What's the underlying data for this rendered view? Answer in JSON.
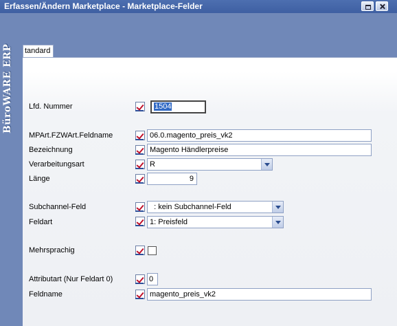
{
  "window": {
    "title": "Erfassen/Ändern Marketplace - Marketplace-Felder"
  },
  "brand": "BüroWARE ERP",
  "tabs": [
    {
      "label": "tandard"
    }
  ],
  "form": {
    "lfd_nummer": {
      "label": "Lfd. Nummer",
      "value": "1504"
    },
    "feldname_mp": {
      "label": "MPArt.FZWArt.Feldname",
      "value": "06.0.magento_preis_vk2"
    },
    "bezeichnung": {
      "label": "Bezeichnung",
      "value": "Magento Händlerpreise"
    },
    "verarbeitungsart": {
      "label": "Verarbeitungsart",
      "value": "R"
    },
    "laenge": {
      "label": "Länge",
      "value": "9"
    },
    "subchannel": {
      "label": "Subchannel-Feld",
      "value": "  : kein Subchannel-Feld"
    },
    "feldart": {
      "label": "Feldart",
      "value": "1: Preisfeld"
    },
    "mehrsprachig": {
      "label": "Mehrsprachig",
      "checked": false
    },
    "attributart": {
      "label": "Attributart (Nur Feldart 0)",
      "value": "0"
    },
    "feldname": {
      "label": "Feldname",
      "value": "magento_preis_vk2"
    }
  },
  "colors": {
    "titlebar": "#3e5fa2",
    "background": "#7088b8",
    "selection": "#316ac5",
    "check_mark": "#c0102a"
  },
  "icons": {
    "edit_check": "red-check-edit-icon",
    "dropdown": "chevron-down-icon"
  }
}
